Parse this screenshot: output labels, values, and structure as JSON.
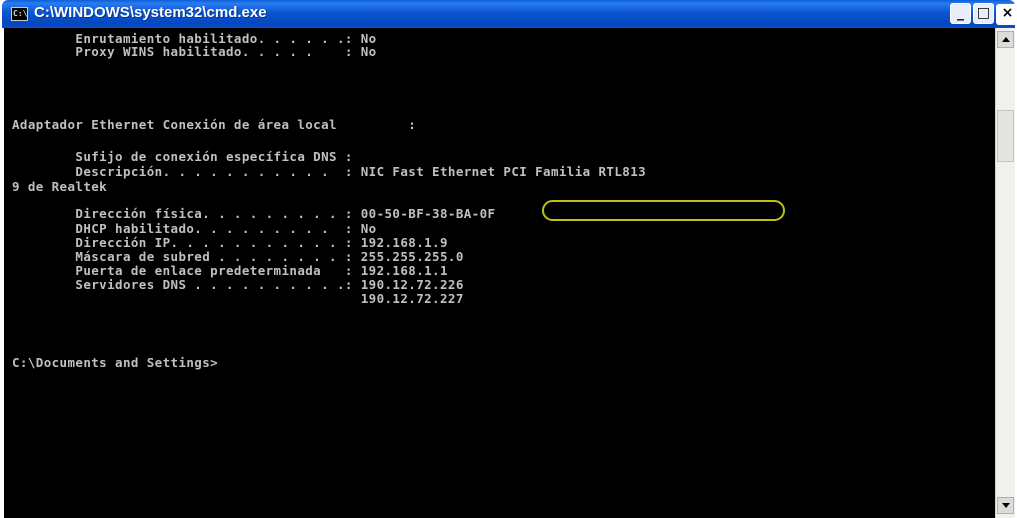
{
  "window": {
    "title": "C:\\WINDOWS\\system32\\cmd.exe",
    "icon_text": "C:\\",
    "minimize_glyph": "_",
    "maximize_glyph": "□",
    "close_glyph": "×"
  },
  "console": {
    "lines": [
      "        Enrutamiento habilitado. . . . . .: No",
      "        Proxy WINS habilitado. . . . .    : No",
      "",
      "Adaptador Ethernet Conexión de área local         :",
      "",
      "        Sufijo de conexión específica DNS :",
      "        Descripción. . . . . . . . . . .  : NIC Fast Ethernet PCI Familia RTL813",
      "9 de Realtek",
      "        Dirección física. . . . . . . . . : 00-50-BF-38-BA-0F",
      "        DHCP habilitado. . . . . . . . .  : No",
      "        Dirección IP. . . . . . . . . . . : 192.168.1.9",
      "        Máscara de subred . . . . . . . . : 255.255.255.0",
      "        Puerta de enlace predeterminada   : 192.168.1.1",
      "        Servidores DNS . . . . . . . . . .: 190.12.72.226",
      "                                            190.12.72.227",
      "",
      "C:\\Documents and Settings>"
    ],
    "highlight_color": "#bfbf1a"
  },
  "colors": {
    "titlebar": "#0a56d0",
    "console_bg": "#000000",
    "console_text": "#c0c0c0"
  }
}
